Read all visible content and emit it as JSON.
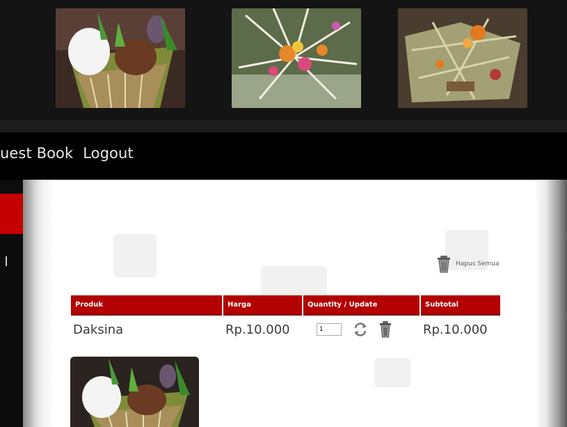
{
  "nav": {
    "items": [
      "uest Book",
      "Logout"
    ]
  },
  "hapus_semua": "Hapus Semua",
  "table": {
    "headers": [
      "Produk",
      "Harga",
      "Quantity / Update",
      "Subtotal"
    ],
    "row": {
      "produk": "Daksina",
      "harga": "Rp.10.000",
      "qty": "1",
      "subtotal": "Rp.10.000"
    }
  },
  "colors": {
    "accent": "#b30000",
    "nav_bg": "#000000",
    "side_active": "#c40000"
  },
  "icons": [
    "refresh-icon",
    "trash-icon"
  ]
}
